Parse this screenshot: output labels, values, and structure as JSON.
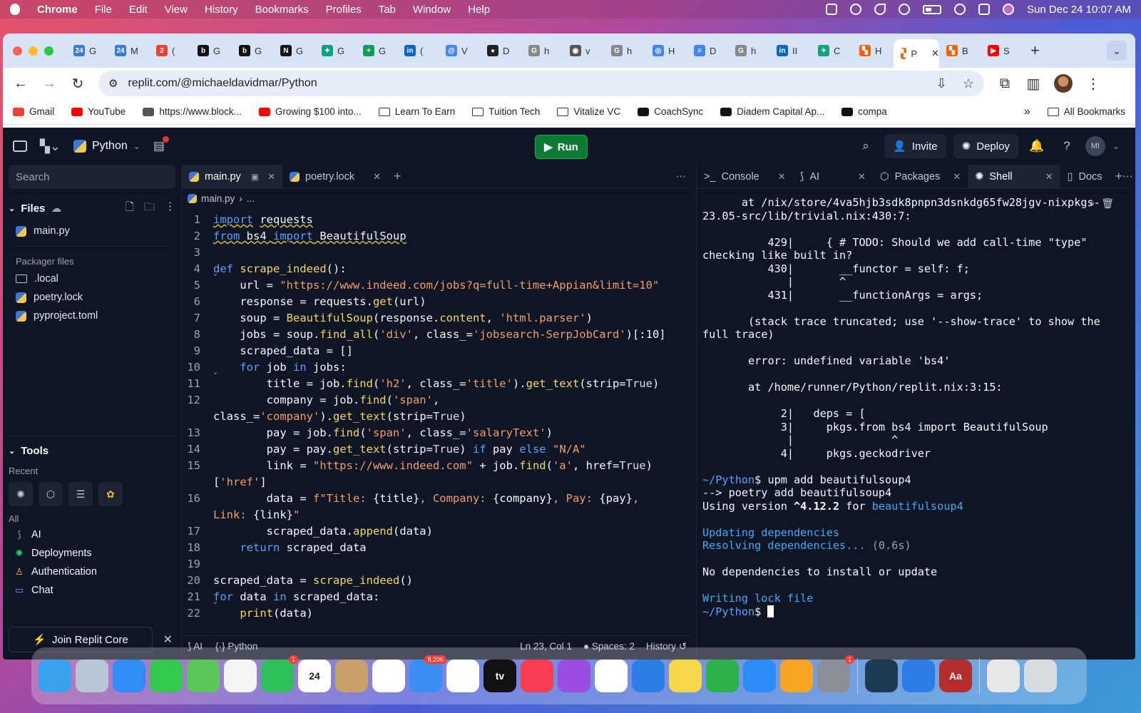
{
  "menubar": {
    "app": "Chrome",
    "items": [
      "File",
      "Edit",
      "View",
      "History",
      "Bookmarks",
      "Profiles",
      "Tab",
      "Window",
      "Help"
    ],
    "datetime": "Sun Dec 24  10:07 AM"
  },
  "browser": {
    "tabs": [
      {
        "short": "G",
        "color": "#3b78d8",
        "icon": "calendar-icon",
        "glyph": "24"
      },
      {
        "short": "M",
        "color": "#3b78d8",
        "icon": "calendar-icon",
        "glyph": "24"
      },
      {
        "short": "(",
        "color": "#ea4335",
        "icon": "chrome-icon",
        "glyph": "2"
      },
      {
        "short": "G",
        "color": "#111111",
        "icon": "b-logo-icon",
        "glyph": "b"
      },
      {
        "short": "G",
        "color": "#111111",
        "icon": "b-logo-icon",
        "glyph": "b"
      },
      {
        "short": "G",
        "color": "#111111",
        "icon": "notion-icon",
        "glyph": "N"
      },
      {
        "short": "G",
        "color": "#10a37f",
        "icon": "openai-icon",
        "glyph": "✦"
      },
      {
        "short": "G",
        "color": "#0f9d58",
        "icon": "sheets-icon",
        "glyph": "+"
      },
      {
        "short": "(",
        "color": "#0a66c2",
        "icon": "linkedin-icon",
        "glyph": "in"
      },
      {
        "short": "V",
        "color": "#4285f4",
        "icon": "globe-icon",
        "glyph": "@"
      },
      {
        "short": "D",
        "color": "#222222",
        "icon": "record-icon",
        "glyph": "●"
      },
      {
        "short": "h",
        "color": "#888888",
        "icon": "google-icon",
        "glyph": "G"
      },
      {
        "short": "v",
        "color": "#555555",
        "icon": "eye-icon",
        "glyph": "◉"
      },
      {
        "short": "h",
        "color": "#888888",
        "icon": "google-icon",
        "glyph": "G"
      },
      {
        "short": "H",
        "color": "#4285f4",
        "icon": "chrome-icon",
        "glyph": "◎"
      },
      {
        "short": "D",
        "color": "#4285f4",
        "icon": "docs-icon",
        "glyph": "≡"
      },
      {
        "short": "h",
        "color": "#888888",
        "icon": "google-icon",
        "glyph": "G"
      },
      {
        "short": "II",
        "color": "#0a66c2",
        "icon": "linkedin-icon",
        "glyph": "in"
      },
      {
        "short": "C",
        "color": "#10a37f",
        "icon": "openai-icon",
        "glyph": "✦"
      },
      {
        "short": "H",
        "color": "#f26207",
        "icon": "replit-icon",
        "glyph": "▚"
      },
      {
        "short": "P",
        "color": "#f26207",
        "icon": "replit-icon",
        "glyph": "▚",
        "active": true
      },
      {
        "short": "B",
        "color": "#f26207",
        "icon": "replit-icon",
        "glyph": "▚"
      },
      {
        "short": "S",
        "color": "#ff0000",
        "icon": "youtube-icon",
        "glyph": "▶"
      }
    ],
    "url": "replit.com/@michaeldavidmar/Python",
    "bookmarks": [
      {
        "label": "Gmail",
        "color": "#ea4335",
        "icon": "gmail-icon"
      },
      {
        "label": "YouTube",
        "color": "#ff0000",
        "icon": "youtube-icon"
      },
      {
        "label": "https://www.block...",
        "color": "#555555",
        "icon": "globe-icon"
      },
      {
        "label": "Growing $100 into...",
        "color": "#ff0000",
        "icon": "youtube-icon"
      },
      {
        "label": "Learn To Earn",
        "folder": true,
        "icon": "folder-icon"
      },
      {
        "label": "Tuition Tech",
        "folder": true,
        "icon": "folder-icon"
      },
      {
        "label": "Vitalize VC",
        "folder": true,
        "icon": "folder-icon"
      },
      {
        "label": "CoachSync",
        "color": "#111111",
        "icon": "b-logo-icon"
      },
      {
        "label": "Diadem Capital Ap...",
        "color": "#111111",
        "icon": "b-logo-icon"
      },
      {
        "label": "compa",
        "color": "#111111",
        "icon": "b-logo-icon"
      }
    ],
    "all_bookmarks": "All Bookmarks"
  },
  "replit": {
    "project": "Python",
    "run_label": "Run",
    "invite_label": "Invite",
    "deploy_label": "Deploy",
    "avatar_initials": "MI",
    "search_placeholder": "Search",
    "files_header": "Files",
    "files": [
      "main.py"
    ],
    "packager_header": "Packager files",
    "packager_files": [
      {
        "name": ".local",
        "icon": "folder-icon"
      },
      {
        "name": "poetry.lock",
        "icon": "python-icon"
      },
      {
        "name": "pyproject.toml",
        "icon": "python-icon"
      }
    ],
    "tools_header": "Tools",
    "recent_label": "Recent",
    "all_label": "All",
    "tools": [
      {
        "label": "AI",
        "icon": "ai-icon",
        "color": "#9da2a6"
      },
      {
        "label": "Deployments",
        "icon": "deploy-icon",
        "color": "#2fce6a"
      },
      {
        "label": "Authentication",
        "icon": "user-icon",
        "color": "#f6b53a"
      },
      {
        "label": "Chat",
        "icon": "chat-icon",
        "color": "#5ca0ff"
      }
    ],
    "join_label": "Join Replit Core",
    "editor_tabs": [
      {
        "label": "main.py",
        "active": true
      },
      {
        "label": "poetry.lock",
        "active": false
      }
    ],
    "breadcrumb": [
      "main.py",
      "..."
    ],
    "status": {
      "ai": "AI",
      "lang": "Python",
      "position": "Ln 23, Col 1",
      "spaces": "Spaces: 2",
      "history": "History"
    },
    "pane_tabs": [
      "Console",
      "AI",
      "Packages",
      "Shell",
      "Docs"
    ],
    "active_pane_tab": "Shell"
  },
  "code_lines": [
    {
      "n": "1",
      "html": "<span class='kw und'>import</span> <span class='tx und'>requests</span>"
    },
    {
      "n": "2",
      "html": "<span class='kw und'>from</span><span class='tx und'> bs4 </span><span class='kw und'>import</span><span class='tx und'> BeautifulSoup</span>"
    },
    {
      "n": "3",
      "html": ""
    },
    {
      "n": "4",
      "html": "<span class='kw'>def</span> <span class='fn'>scrape_indeed</span><span class='tx'>():</span>",
      "fold": true
    },
    {
      "n": "5",
      "html": "    <span class='tx'>url = </span><span class='st'>\"https://www.indeed.com/jobs?q=full-time+Appian&amp;limit=10\"</span>"
    },
    {
      "n": "6",
      "html": "    <span class='tx'>response = requests.</span><span class='fn'>get</span><span class='tx'>(url)</span>"
    },
    {
      "n": "7",
      "html": "    <span class='tx'>soup = </span><span class='fn'>BeautifulSoup</span><span class='tx'>(response.</span><span class='fn'>content</span><span class='tx'>, </span><span class='st'>'html.parser'</span><span class='tx'>)</span>"
    },
    {
      "n": "8",
      "html": "    <span class='tx'>jobs = soup.</span><span class='fn'>find_all</span><span class='tx'>(</span><span class='st'>'div'</span><span class='tx'>, class_=</span><span class='st'>'jobsearch-SerpJobCard'</span><span class='tx'>)[:10]</span>"
    },
    {
      "n": "9",
      "html": "    <span class='tx'>scraped_data = []</span>"
    },
    {
      "n": "10",
      "html": "    <span class='kw'>for</span><span class='tx'> job </span><span class='kw'>in</span><span class='tx'> jobs:</span>",
      "fold": true
    },
    {
      "n": "11",
      "html": "        <span class='tx'>title = job.</span><span class='fn'>find</span><span class='tx'>(</span><span class='st'>'h2'</span><span class='tx'>, class_=</span><span class='st'>'title'</span><span class='tx'>).</span><span class='fn'>get_text</span><span class='tx'>(strip=</span><span class='bi'>True</span><span class='tx'>)</span>"
    },
    {
      "n": "12",
      "html": "        <span class='tx'>company = job.</span><span class='fn'>find</span><span class='tx'>(</span><span class='st'>'span'</span><span class='tx'>,</span>"
    },
    {
      "n": "",
      "html": "<span class='tx'>class_=</span><span class='st'>'company'</span><span class='tx'>).</span><span class='fn'>get_text</span><span class='tx'>(strip=</span><span class='bi'>True</span><span class='tx'>)</span>"
    },
    {
      "n": "13",
      "html": "        <span class='tx'>pay = job.</span><span class='fn'>find</span><span class='tx'>(</span><span class='st'>'span'</span><span class='tx'>, class_=</span><span class='st'>'salaryText'</span><span class='tx'>)</span>"
    },
    {
      "n": "14",
      "html": "        <span class='tx'>pay = pay.</span><span class='fn'>get_text</span><span class='tx'>(strip=</span><span class='bi'>True</span><span class='tx'>) </span><span class='kw'>if</span><span class='tx'> pay </span><span class='kw'>else</span> <span class='st'>\"N/A\"</span>"
    },
    {
      "n": "15",
      "html": "        <span class='tx'>link = </span><span class='st'>\"https://www.indeed.com\"</span><span class='tx'> + job.</span><span class='fn'>find</span><span class='tx'>(</span><span class='st'>'a'</span><span class='tx'>, href=</span><span class='bi'>True</span><span class='tx'>)</span>"
    },
    {
      "n": "",
      "html": "<span class='tx'>[</span><span class='st'>'href'</span><span class='tx'>]</span>"
    },
    {
      "n": "16",
      "html": "        <span class='tx'>data = </span><span class='st'>f\"Title: </span><span class='tx'>{title}</span><span class='st'>, Company: </span><span class='tx'>{company}</span><span class='st'>, Pay: </span><span class='tx'>{pay}</span><span class='st'>,</span>"
    },
    {
      "n": "",
      "html": "<span class='st'>Link: </span><span class='tx'>{link}</span><span class='st'>\"</span>"
    },
    {
      "n": "17",
      "html": "        <span class='tx'>scraped_data.</span><span class='fn'>append</span><span class='tx'>(data)</span>"
    },
    {
      "n": "18",
      "html": "    <span class='kw'>return</span><span class='tx'> scraped_data</span>"
    },
    {
      "n": "19",
      "html": ""
    },
    {
      "n": "20",
      "html": "<span class='tx'>scraped_data = </span><span class='fn'>scrape_indeed</span><span class='tx'>()</span>"
    },
    {
      "n": "21",
      "html": "<span class='kw'>for</span><span class='tx'> data </span><span class='kw'>in</span><span class='tx'> scraped_data:</span>",
      "fold": true
    },
    {
      "n": "22",
      "html": "    <span class='fn'>print</span><span class='tx'>(data)</span>"
    }
  ],
  "shell_html": "      at /nix/store/4va5hjb3sdk8pnpn3dsnkdg65fw28jgv-nixpkgs-\n23.05-src/lib/trivial.nix:430:7:\n\n          429|     { # TODO: Should we add call-time \"type\" checking like built in?\n          430|       __functor = self: f;\n             |       ^\n          431|       __functionArgs = args;\n\n       (stack trace truncated; use '--show-trace' to show the full trace)\n\n       error: undefined variable 'bs4'\n\n       at /home/runner/Python/replit.nix:3:15:\n\n            2|   deps = [\n            3|     pkgs.from bs4 import BeautifulSoup\n             |               ^\n            4|     pkgs.geckodriver\n\n<span class='sh-prompt'>~/Python</span>$ upm add beautifulsoup4\n--> poetry add beautifulsoup4\nUsing version <b>^4.12.2</b> for <span class='sh-blue'>beautifulsoup4</span>\n\n<span class='sh-blue'>Updating dependencies</span>\n<span class='sh-blue'>Resolving dependencies...</span> <span class='sh-gray'>(0.6s)</span>\n\nNo dependencies to install or update\n\n<span class='sh-blue'>Writing lock file</span>\n<span class='sh-prompt'>~/Python</span>$ <span class='cursor'></span>",
  "dock": [
    {
      "name": "finder",
      "color": "#3aa0f0"
    },
    {
      "name": "launchpad",
      "color": "#b9c6d8"
    },
    {
      "name": "safari",
      "color": "#2f8df5"
    },
    {
      "name": "messages",
      "color": "#33c84f"
    },
    {
      "name": "maps",
      "color": "#5bc65c"
    },
    {
      "name": "photos",
      "color": "#f5f5f5"
    },
    {
      "name": "facetime",
      "color": "#2fc05b",
      "badge": "1"
    },
    {
      "name": "calendar",
      "color": "#ffffff",
      "label": "24"
    },
    {
      "name": "contacts",
      "color": "#c8a06a"
    },
    {
      "name": "chrome",
      "color": "#ffffff"
    },
    {
      "name": "mail",
      "color": "#3a8ef5",
      "badge": "8,206"
    },
    {
      "name": "reminders",
      "color": "#ffffff"
    },
    {
      "name": "tv",
      "color": "#111111",
      "label": "tv"
    },
    {
      "name": "music",
      "color": "#fa3c52"
    },
    {
      "name": "podcasts",
      "color": "#9b4ee0"
    },
    {
      "name": "news",
      "color": "#ffffff"
    },
    {
      "name": "keynote",
      "color": "#2c7de6"
    },
    {
      "name": "notes",
      "color": "#f8d84a"
    },
    {
      "name": "numbers",
      "color": "#2bb04a"
    },
    {
      "name": "app-store",
      "color": "#2c8cf5"
    },
    {
      "name": "pages",
      "color": "#f6a623"
    },
    {
      "name": "system-settings",
      "color": "#8a8f98",
      "badge": "1"
    },
    {
      "name": "instruments",
      "color": "#1c3a52"
    },
    {
      "name": "screen-sharing",
      "color": "#2c7de6"
    },
    {
      "name": "dictionary",
      "color": "#b42c2c",
      "label": "Aa"
    },
    {
      "name": "archive-utility",
      "color": "#e8e8e8"
    },
    {
      "name": "trash",
      "color": "#d8dde2"
    }
  ]
}
